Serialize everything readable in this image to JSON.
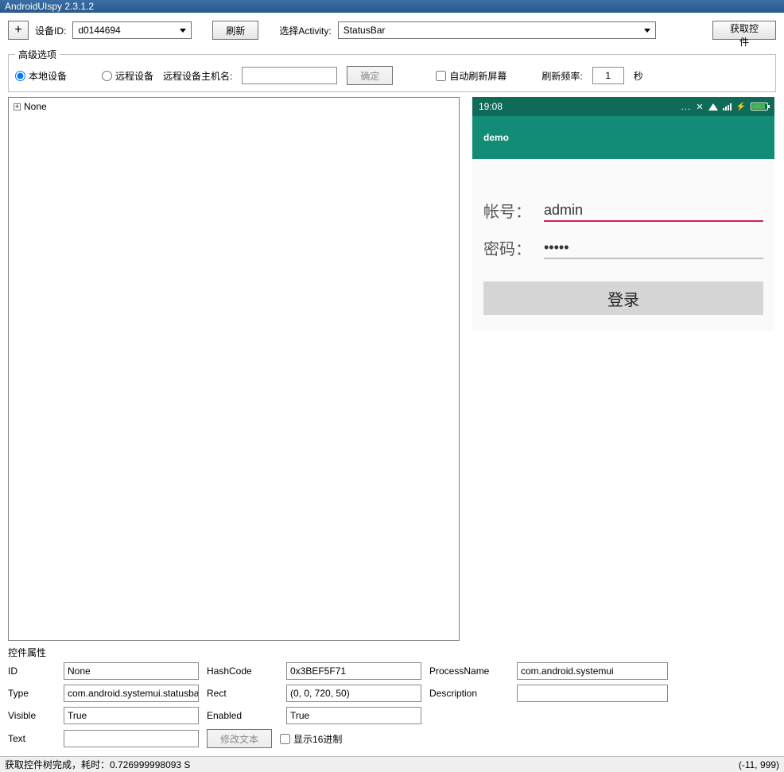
{
  "window": {
    "title": "AndroidUIspy 2.3.1.2"
  },
  "toolbar": {
    "add_label": "+",
    "device_label": "设备ID:",
    "device_value": "d0144694",
    "refresh_label": "刷新",
    "activity_label": "选择Activity:",
    "activity_value": "StatusBar",
    "fetch_label": "获取控件"
  },
  "advanced": {
    "legend": "高级选项",
    "local_label": "本地设备",
    "remote_label": "远程设备",
    "host_label": "远程设备主机名:",
    "confirm_label": "确定",
    "auto_refresh_label": "自动刷新屏幕",
    "refresh_rate_label": "刷新频率:",
    "refresh_rate_value": "1",
    "seconds_label": "秒",
    "local_checked": true,
    "auto_refresh_checked": false
  },
  "tree": {
    "root_label": "None",
    "expander": "+"
  },
  "phone": {
    "time": "19:08",
    "status_dots": "...",
    "app_title": "demo",
    "account_label": "帐号：",
    "account_value": "admin",
    "password_label": "密码：",
    "password_value": "•••••",
    "login_label": "登录"
  },
  "props": {
    "header": "控件属性",
    "labels": {
      "id": "ID",
      "hashcode": "HashCode",
      "processname": "ProcessName",
      "type": "Type",
      "rect": "Rect",
      "description": "Description",
      "visible": "Visible",
      "enabled": "Enabled",
      "text": "Text"
    },
    "values": {
      "id": "None",
      "hashcode": "0x3BEF5F71",
      "processname": "com.android.systemui",
      "type": "com.android.systemui.statusbar",
      "rect": "(0, 0, 720, 50)",
      "description": "",
      "visible": "True",
      "enabled": "True",
      "text": ""
    },
    "modify_text_label": "修改文本",
    "show_hex_label": "显示16进制"
  },
  "statusbar": {
    "left": "获取控件树完成，耗时：0.726999998093 S",
    "right": "(-11, 999)"
  }
}
